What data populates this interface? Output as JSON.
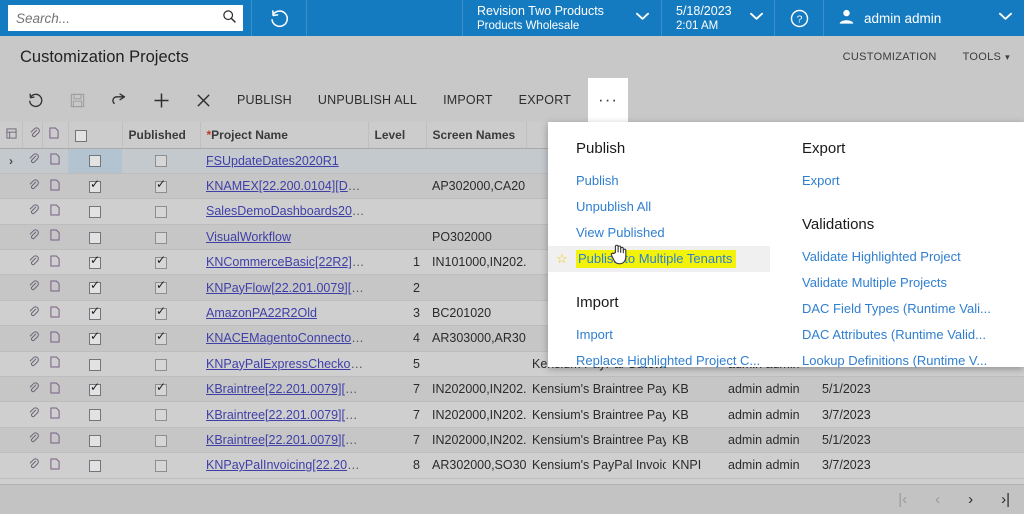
{
  "topbar": {
    "search_placeholder": "Search...",
    "search_value": "",
    "search_icon": "search-icon",
    "recent_icon": "recent-history-icon",
    "branch_line1": "Revision Two Products",
    "branch_line2": "Products Wholesale",
    "date_line1": "5/18/2023",
    "date_line2": "2:01 AM",
    "help_icon": "help-circle-icon",
    "user_icon": "user-avatar-icon",
    "user_name": "admin admin",
    "caret": "⌄",
    "accent_color": "#157bc0"
  },
  "titlebar": {
    "page_title": "Customization Projects",
    "customization_label": "CUSTOMIZATION",
    "tools_label": "TOOLS"
  },
  "toolbar": {
    "refresh_icon": "refresh-icon",
    "save_icon": "save-icon",
    "undo_icon": "undo-icon",
    "add_icon": "plus-icon",
    "delete_icon": "close-x-icon",
    "publish_label": "PUBLISH",
    "unpublish_all_label": "UNPUBLISH ALL",
    "import_label": "IMPORT",
    "export_label": "EXPORT",
    "more_label": "···"
  },
  "menu": {
    "left": [
      {
        "type": "header",
        "label": "Publish"
      },
      {
        "type": "item",
        "label": "Publish",
        "highlighted": false
      },
      {
        "type": "item",
        "label": "Unpublish All",
        "highlighted": false
      },
      {
        "type": "item",
        "label": "View Published",
        "highlighted": false
      },
      {
        "type": "item",
        "label": "Publish to Multiple Tenants",
        "highlighted": true
      },
      {
        "type": "header",
        "label": "Import"
      },
      {
        "type": "item",
        "label": "Import",
        "highlighted": false
      },
      {
        "type": "item",
        "label": "Replace Highlighted Project C...",
        "highlighted": false
      }
    ],
    "right": [
      {
        "type": "header",
        "label": "Export"
      },
      {
        "type": "item",
        "label": "Export",
        "highlighted": false
      },
      {
        "type": "header",
        "label": "Validations"
      },
      {
        "type": "item",
        "label": "Validate Highlighted Project",
        "highlighted": false
      },
      {
        "type": "item",
        "label": "Validate Multiple Projects",
        "highlighted": false
      },
      {
        "type": "item",
        "label": "DAC Field Types (Runtime Vali...",
        "highlighted": false
      },
      {
        "type": "item",
        "label": "DAC Attributes (Runtime Valid...",
        "highlighted": false
      },
      {
        "type": "item",
        "label": "Lookup Definitions (Runtime V...",
        "highlighted": false
      }
    ],
    "highlight_color": "#f2f20b",
    "link_color": "#2f7fd0",
    "star_icon": "star-icon"
  },
  "grid": {
    "headers": {
      "indicator": "",
      "files_icon": "files-column-icon",
      "clip_icon": "paperclip-icon",
      "note_icon": "note-icon",
      "select_all": "",
      "published": "Published",
      "project_name": "Project Name",
      "project_name_required": "*",
      "level": "Level",
      "screen_names": "Screen Names",
      "description": "",
      "prefix": "",
      "last_modified_by": "",
      "last_modified_date": ""
    },
    "rows": [
      {
        "selected": true,
        "checked": false,
        "published": false,
        "name": "FSUpdateDates2020R1",
        "truncated": false,
        "level": "",
        "screens": "",
        "desc": "",
        "prefix": "",
        "by": "",
        "date": ""
      },
      {
        "selected": false,
        "checked": true,
        "published": true,
        "name": "KNAMEX[22.200.0104][D",
        "truncated": true,
        "level": "",
        "screens": "AP302000,CA20...",
        "desc": "",
        "prefix": "",
        "by": "",
        "date": ""
      },
      {
        "selected": false,
        "checked": false,
        "published": false,
        "name": "SalesDemoDashboards20",
        "truncated": true,
        "level": "",
        "screens": "",
        "desc": "",
        "prefix": "",
        "by": "",
        "date": ""
      },
      {
        "selected": false,
        "checked": false,
        "published": false,
        "name": "VisualWorkflow",
        "truncated": false,
        "level": "",
        "screens": "PO302000",
        "desc": "",
        "prefix": "",
        "by": "",
        "date": ""
      },
      {
        "selected": false,
        "checked": true,
        "published": true,
        "name": "KNCommerceBasic[22R2]",
        "truncated": true,
        "level": "1",
        "screens": "IN101000,IN202...",
        "desc": "",
        "prefix": "",
        "by": "",
        "date": ""
      },
      {
        "selected": false,
        "checked": true,
        "published": true,
        "name": "KNPayFlow[22.201.0079][",
        "truncated": true,
        "level": "2",
        "screens": "",
        "desc": "",
        "prefix": "",
        "by": "",
        "date": ""
      },
      {
        "selected": false,
        "checked": true,
        "published": true,
        "name": "AmazonPA22R2Old",
        "truncated": false,
        "level": "3",
        "screens": "BC201020",
        "desc": "",
        "prefix": "",
        "by": "",
        "date": ""
      },
      {
        "selected": false,
        "checked": true,
        "published": true,
        "name": "KNACEMagentoConnecto",
        "truncated": true,
        "level": "4",
        "screens": "AR303000,AR30...",
        "desc": "",
        "prefix": "",
        "by": "",
        "date": ""
      },
      {
        "selected": false,
        "checked": false,
        "published": false,
        "name": "KNPayPalExpressChecko",
        "truncated": true,
        "level": "5",
        "screens": "",
        "desc": "Kensium PayPal Gateway...",
        "prefix": "",
        "by": "admin admin",
        "date": ""
      },
      {
        "selected": false,
        "checked": true,
        "published": true,
        "name": "KBraintree[22.201.0079][",
        "truncated": true,
        "level": "7",
        "screens": "IN202000,IN202...",
        "desc": "Kensium's Braintree Pay...",
        "prefix": "KB",
        "by": "admin admin",
        "date": "5/1/2023"
      },
      {
        "selected": false,
        "checked": false,
        "published": false,
        "name": "KBraintree[22.201.0079][",
        "truncated": true,
        "level": "7",
        "screens": "IN202000,IN202...",
        "desc": "Kensium's Braintree Pay...",
        "prefix": "KB",
        "by": "admin admin",
        "date": "3/7/2023"
      },
      {
        "selected": false,
        "checked": false,
        "published": false,
        "name": "KBraintree[22.201.0079][",
        "truncated": true,
        "level": "7",
        "screens": "IN202000,IN202...",
        "desc": "Kensium's Braintree Pay...",
        "prefix": "KB",
        "by": "admin admin",
        "date": "5/1/2023"
      },
      {
        "selected": false,
        "checked": false,
        "published": false,
        "name": "KNPayPalInvoicing[22.20",
        "truncated": true,
        "level": "8",
        "screens": "AR302000,SO30...",
        "desc": "Kensium's PayPal Invoici...",
        "prefix": "KNPI",
        "by": "admin admin",
        "date": "3/7/2023"
      }
    ]
  },
  "pager": {
    "first": "|‹",
    "prev": "‹",
    "next": "›",
    "last": "›|",
    "first_enabled": false,
    "prev_enabled": false,
    "next_enabled": true,
    "last_enabled": true
  }
}
